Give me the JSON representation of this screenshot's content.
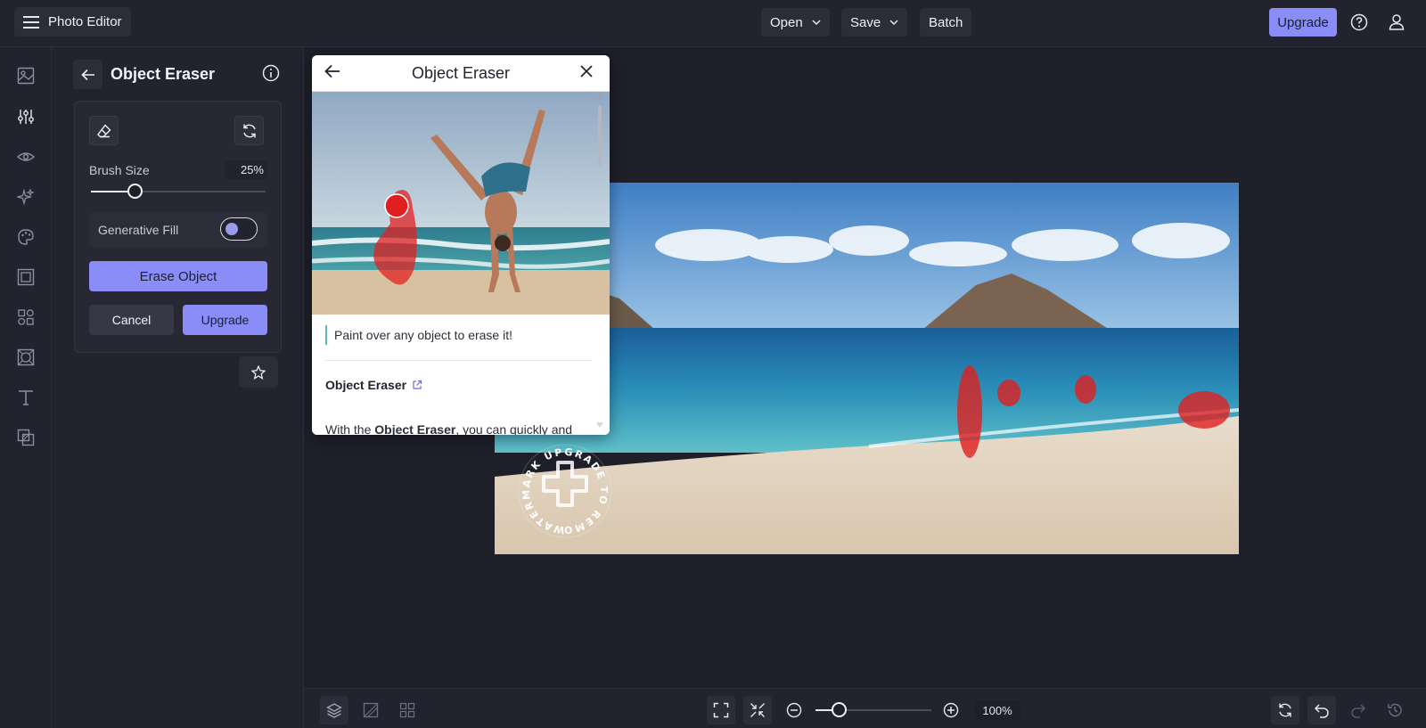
{
  "header": {
    "app_title": "Photo Editor",
    "open_label": "Open",
    "save_label": "Save",
    "batch_label": "Batch",
    "upgrade_label": "Upgrade"
  },
  "rail": {
    "icons": [
      "image-icon",
      "adjust-icon",
      "eye-icon",
      "sparkle-icon",
      "palette-icon",
      "frame-icon",
      "shapes-icon",
      "texture-icon",
      "text-icon",
      "overlay-icon"
    ],
    "active_index": 1
  },
  "panel": {
    "title": "Object Eraser",
    "brush_size_label": "Brush Size",
    "brush_size_value": "25%",
    "brush_size_percent": 25,
    "generative_fill_label": "Generative Fill",
    "generative_fill_on": false,
    "erase_button_label": "Erase Object",
    "cancel_label": "Cancel",
    "upgrade_label": "Upgrade"
  },
  "popup": {
    "title": "Object Eraser",
    "tip": "Paint over any object to erase it!",
    "link_title": "Object Eraser",
    "body_prefix": "With the ",
    "body_bold": "Object Eraser",
    "body_suffix": ", you can quickly and"
  },
  "watermark": {
    "text": "WATERMARK UPGRADE TO REMOVE"
  },
  "zoom": {
    "value": "100%",
    "percent": 20
  },
  "colors": {
    "accent": "#8a8df7",
    "background": "#1e1f29",
    "panel": "#22232e",
    "mask_red": "#e02020"
  }
}
